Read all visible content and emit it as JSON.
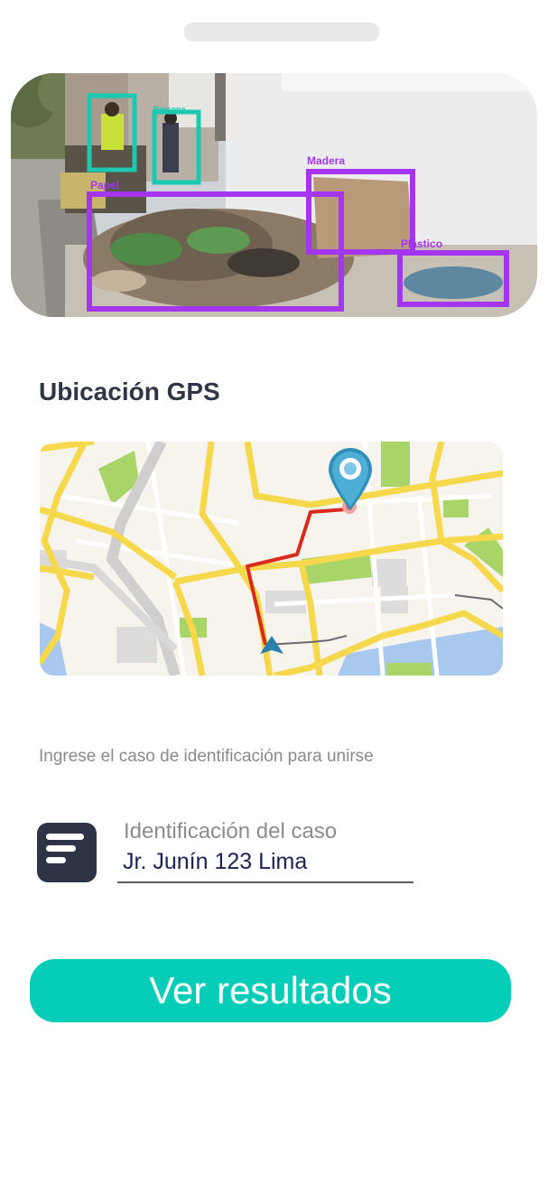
{
  "photo": {
    "detections": [
      {
        "label": "Persona",
        "color": "#1cc9b0"
      },
      {
        "label": "Persona",
        "color": "#1cc9b0"
      },
      {
        "label": "Madera",
        "color": "#a435f0"
      },
      {
        "label": "Papel",
        "color": "#a435f0"
      },
      {
        "label": "Plastico",
        "color": "#a435f0"
      }
    ]
  },
  "gps": {
    "title": "Ubicación GPS",
    "icons": {
      "pin": "location-pin-icon",
      "arrow": "navigation-arrow-icon"
    },
    "route_color": "#d92b1c"
  },
  "join": {
    "instructions": "Ingrese el caso de identificación para unirse",
    "field_label": "Identificación del caso",
    "field_value": "Jr. Junín 123 Lima",
    "icon": "document-lines-icon"
  },
  "cta": {
    "label": "Ver resultados",
    "color": "#06cdb8"
  }
}
